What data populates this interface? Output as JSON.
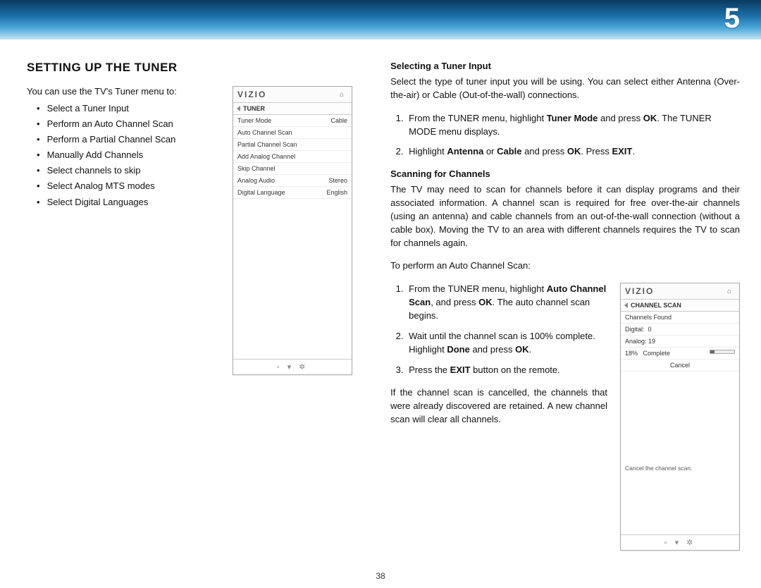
{
  "chapter": "5",
  "page_number": "38",
  "section_title": "SETTING UP THE TUNER",
  "left": {
    "intro": "You can use the TV's Tuner menu to:",
    "bullets": [
      "Select a Tuner Input",
      "Perform an Auto Channel Scan",
      "Perform a Partial Channel Scan",
      "Manually Add Channels",
      "Select channels to skip",
      "Select Analog MTS modes",
      "Select Digital Languages"
    ]
  },
  "tuner_menu": {
    "brand": "VIZIO",
    "crumb": "TUNER",
    "rows": [
      {
        "label": "Tuner Mode",
        "value": "Cable"
      },
      {
        "label": "Auto Channel Scan",
        "value": ""
      },
      {
        "label": "Partial Channel Scan",
        "value": ""
      },
      {
        "label": "Add Analog Channel",
        "value": ""
      },
      {
        "label": "Skip Channel",
        "value": ""
      },
      {
        "label": "Analog Audio",
        "value": "Stereo"
      },
      {
        "label": "Digital Language",
        "value": "English"
      }
    ],
    "footer": "▫ ▾ ✲"
  },
  "right": {
    "sub1_title": "Selecting a Tuner Input",
    "sub1_para": "Select the type of tuner input you will be using. You can select either Antenna (Over-the-air) or Cable (Out-of-the-wall) connections.",
    "sub1_step1_a": "From the TUNER menu, highlight ",
    "sub1_step1_b": "Tuner Mode",
    "sub1_step1_c": " and press ",
    "sub1_step1_d": "OK",
    "sub1_step1_e": ". The TUNER MODE menu displays.",
    "sub1_step2_a": "Highlight ",
    "sub1_step2_b": "Antenna",
    "sub1_step2_c": " or ",
    "sub1_step2_d": "Cable",
    "sub1_step2_e": " and press ",
    "sub1_step2_f": "OK",
    "sub1_step2_g": ". Press ",
    "sub1_step2_h": "EXIT",
    "sub1_step2_i": ".",
    "sub2_title": "Scanning for Channels",
    "sub2_para": "The TV may need to scan for channels before it can display programs and their associated information. A channel scan is required for free over-the-air channels (using an antenna) and cable channels from an out-of-the-wall connection (without a cable box). Moving the TV to an area with different channels requires the TV to scan for channels again.",
    "sub2_intro": "To perform an Auto Channel Scan:",
    "s1_a": "From the TUNER menu, highlight ",
    "s1_b": "Auto Channel Scan",
    "s1_c": ", and press ",
    "s1_d": "OK",
    "s1_e": ". The auto channel scan begins.",
    "s2_a": "Wait until the channel scan is 100% complete. Highlight ",
    "s2_b": "Done",
    "s2_c": " and press ",
    "s2_d": "OK",
    "s2_e": ".",
    "s3_a": "Press the ",
    "s3_b": "EXIT",
    "s3_c": " button on the remote.",
    "after": "If the channel scan is cancelled, the channels that were already discovered are retained. A new channel scan will clear all channels."
  },
  "scan_menu": {
    "brand": "VIZIO",
    "crumb": "CHANNEL SCAN",
    "rows": [
      {
        "label": "Channels Found",
        "value": ""
      },
      {
        "label": "Digital:",
        "value": "0"
      },
      {
        "label": "Analog:",
        "value": "19"
      }
    ],
    "progress_pct": "18%",
    "progress_label": "Complete",
    "cancel": "Cancel",
    "hint": "Cancel the channel scan.",
    "footer": "▫ ▾ ✲"
  }
}
